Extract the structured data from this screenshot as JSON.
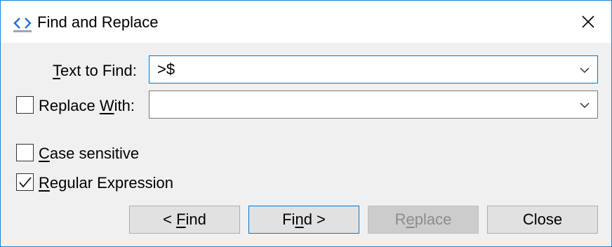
{
  "window": {
    "title": "Find and Replace",
    "accent_color": "#1883d7",
    "icons": {
      "app": "code-brackets-icon",
      "close": "close-icon"
    }
  },
  "find": {
    "label_prefix": "",
    "label_mnemonic": "T",
    "label_rest": "ext to Find:",
    "value": ">$"
  },
  "replace": {
    "checked": false,
    "label_prefix": "Replace ",
    "label_mnemonic": "W",
    "label_rest": "ith:",
    "value": ""
  },
  "options": {
    "case_sensitive": {
      "checked": false,
      "mnemonic": "C",
      "rest": "ase sensitive"
    },
    "regex": {
      "checked": true,
      "mnemonic": "R",
      "rest": "egular Expression"
    }
  },
  "buttons": {
    "find_prev": {
      "prefix": "< ",
      "mnemonic": "F",
      "rest": "ind"
    },
    "find_next": {
      "prefix": "Fi",
      "mnemonic": "n",
      "rest": "d >"
    },
    "replace": {
      "prefix": "R",
      "mnemonic": "e",
      "rest": "place",
      "enabled": false
    },
    "close": {
      "label": "Close"
    }
  }
}
